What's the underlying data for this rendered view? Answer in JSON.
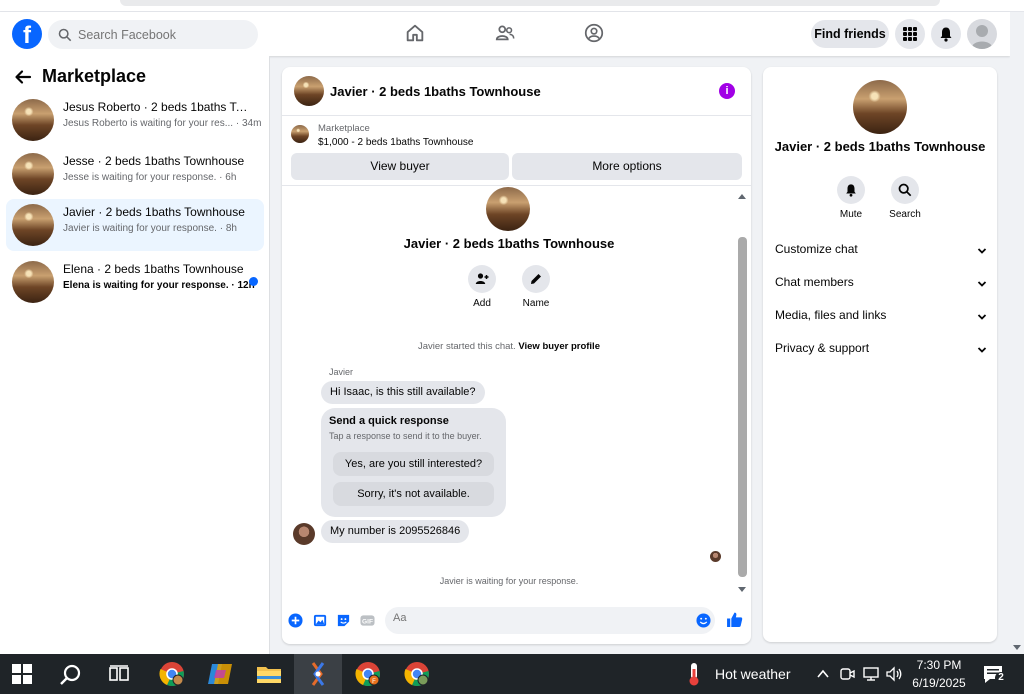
{
  "search": {
    "placeholder": "Search Facebook"
  },
  "topnav": {
    "find_friends": "Find friends"
  },
  "sidebar": {
    "title": "Marketplace",
    "conversations": [
      {
        "name": "Jesus Roberto · 2 beds 1baths Tow...",
        "sub": "Jesus Roberto is waiting for your res... · 34m",
        "active": false,
        "unread": false
      },
      {
        "name": "Jesse · 2 beds 1baths Townhouse",
        "sub": "Jesse is waiting for your response. · 6h",
        "active": false,
        "unread": false
      },
      {
        "name": "Javier · 2 beds 1baths Townhouse",
        "sub": "Javier is waiting for your response. · 8h",
        "active": true,
        "unread": false
      },
      {
        "name": "Elena · 2 beds 1baths Townhouse",
        "sub": "Elena is waiting for your response. · 12h",
        "active": false,
        "unread": true
      }
    ]
  },
  "chat": {
    "title": "Javier · 2 beds 1baths Townhouse",
    "listing_source": "Marketplace",
    "listing_price": "$1,000 - 2 beds 1baths Townhouse",
    "view_buyer": "View buyer",
    "more_options": "More options",
    "big_title": "Javier · 2 beds 1baths Townhouse",
    "add_label": "Add",
    "name_label": "Name",
    "system_text": "Javier started this chat.",
    "system_link": "View buyer profile",
    "sender_name": "Javier",
    "message_1": "Hi Isaac, is this still available?",
    "quick_title": "Send a quick response",
    "quick_sub": "Tap a response to send it to the buyer.",
    "quick_opt_1": "Yes, are you still interested?",
    "quick_opt_2": "Sorry, it's not available.",
    "message_2": "My number is 2095526846",
    "waiting": "Javier is waiting for your response.",
    "composer_placeholder": "Aa"
  },
  "info": {
    "title": "Javier · 2 beds 1baths Townhouse",
    "mute": "Mute",
    "search": "Search",
    "sections": [
      "Customize chat",
      "Chat members",
      "Media, files and links",
      "Privacy & support"
    ]
  },
  "taskbar": {
    "weather": "Hot weather",
    "time": "7:30 PM",
    "date": "6/19/2025",
    "notifications": "2"
  },
  "colors": {
    "fb_blue": "#0866ff",
    "info_purple": "#a100e6",
    "active_row": "#ebf5ff"
  }
}
